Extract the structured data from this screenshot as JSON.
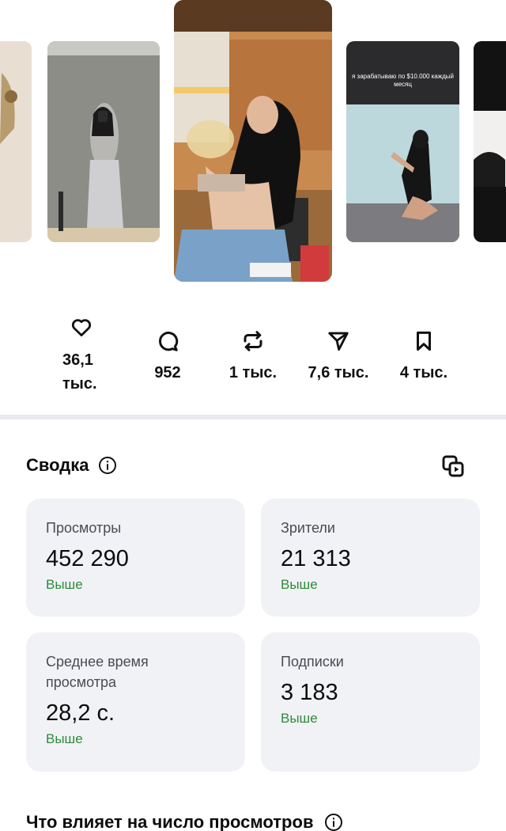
{
  "carousel": {
    "items": [
      {
        "id": "far-left"
      },
      {
        "id": "left"
      },
      {
        "id": "center"
      },
      {
        "id": "right",
        "caption": "я зарабатываю по $10.000 каждый месяц"
      },
      {
        "id": "far-right"
      }
    ]
  },
  "stats": {
    "likes": {
      "icon": "heart-icon",
      "value": "36,1 тыс."
    },
    "comments": {
      "icon": "comment-icon",
      "value": "952"
    },
    "reposts": {
      "icon": "repost-icon",
      "value": "1 тыс."
    },
    "shares": {
      "icon": "send-icon",
      "value": "7,6 тыс."
    },
    "saves": {
      "icon": "bookmark-icon",
      "value": "4 тыс."
    }
  },
  "summary": {
    "title": "Сводка",
    "info_icon": "info-icon",
    "copy_icon": "copy-icon",
    "cards": {
      "views": {
        "label": "Просмотры",
        "value": "452 290",
        "trend": "Выше"
      },
      "viewers": {
        "label": "Зрители",
        "value": "21 313",
        "trend": "Выше"
      },
      "avg_watch": {
        "label": "Среднее время просмотра",
        "value": "28,2 с.",
        "trend": "Выше"
      },
      "follows": {
        "label": "Подписки",
        "value": "3 183",
        "trend": "Выше"
      }
    },
    "trend_color": "#2f8a3c"
  },
  "influence": {
    "title": "Что влияет на число просмотров"
  }
}
